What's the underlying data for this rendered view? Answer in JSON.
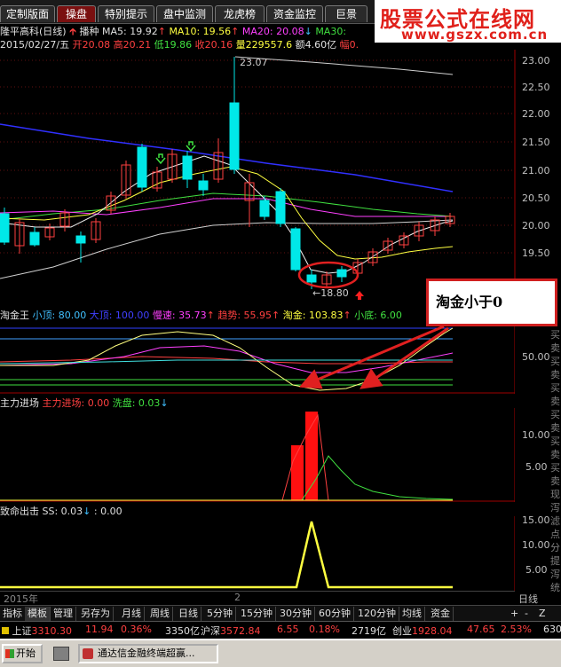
{
  "tabs": [
    {
      "label": "定制版面",
      "active": false
    },
    {
      "label": "操盘",
      "active": true
    },
    {
      "label": "特别提示",
      "active": false
    },
    {
      "label": "盘中监测",
      "active": false
    },
    {
      "label": "龙虎榜",
      "active": false
    },
    {
      "label": "资金监控",
      "active": false
    },
    {
      "label": "巨景",
      "active": false
    }
  ],
  "brand": {
    "title": "股票公式在线网",
    "url": "www.gszx.com.cn"
  },
  "stock_line": {
    "name": "隆平高科(日线)",
    "broadcast": "播种",
    "ma5": "MA5: 19.92",
    "ma10": "MA10: 19.56",
    "ma20": "MA20: 20.08",
    "ma30": "MA30:"
  },
  "ohlc_line": {
    "date": "2015/02/27/五",
    "open": "开20.08",
    "high": "高20.21",
    "low": "低19.86",
    "close": "收20.16",
    "vol": "量229557.6",
    "amount": "额4.60亿",
    "amp": "幅0."
  },
  "main_chart": {
    "yticks": [
      "23.00",
      "22.50",
      "22.00",
      "21.50",
      "21.00",
      "20.50",
      "20.00",
      "19.50"
    ],
    "high_label": "23.07",
    "low_label": "18.80"
  },
  "taojin": {
    "title": "淘金王",
    "items": [
      {
        "label": "小顶: 80.00",
        "color": "#40c0ff"
      },
      {
        "label": "大顶: 100.00",
        "color": "#4040ff"
      },
      {
        "label": "慢速: 35.73",
        "color": "#ff40ff"
      },
      {
        "label": "趋势: 55.95",
        "color": "#ff4040"
      },
      {
        "label": "淘金: 103.83",
        "color": "#ffff40"
      },
      {
        "label": "小底: 6.00",
        "color": "#40e040"
      }
    ],
    "ytick": "50.00"
  },
  "zhuli": {
    "title": "主力进场",
    "items": [
      {
        "label": "主力进场: 0.00",
        "color": "#ff4040"
      },
      {
        "label": "洗盘: 0.03",
        "color": "#40e040"
      }
    ],
    "yticks": [
      "10.00",
      "5.00"
    ]
  },
  "zhiming": {
    "title": "致命出击",
    "items": [
      {
        "label": "SS: 0.03",
        "color": "#e0e0e0"
      },
      {
        "label": ": 0.00",
        "color": "#e0e0e0"
      }
    ],
    "yticks": [
      "15.00",
      "10.00",
      "5.00"
    ]
  },
  "callout": {
    "text": "淘金小于0"
  },
  "time_axis": {
    "year": "2015年",
    "mark": "2",
    "period": "日线"
  },
  "side_text": [
    "买",
    "卖",
    "买",
    "卖",
    "买",
    "卖",
    "买",
    "卖",
    "买",
    "卖",
    "买",
    "卖",
    "现",
    "泻",
    "滤",
    "点",
    "分",
    "提",
    "泻",
    "统"
  ],
  "bottom_tabs": [
    {
      "label": "指标",
      "active": false
    },
    {
      "label": "模板",
      "active": true
    },
    {
      "label": "管理",
      "active": false
    },
    {
      "label": "另存为",
      "active": false
    },
    {
      "label": "月线",
      "active": false
    },
    {
      "label": "周线",
      "active": false
    },
    {
      "label": "日线",
      "active": false
    },
    {
      "label": "5分钟",
      "active": false
    },
    {
      "label": "15分钟",
      "active": false
    },
    {
      "label": "30分钟",
      "active": false
    },
    {
      "label": "60分钟",
      "active": false
    },
    {
      "label": "120分钟",
      "active": false
    },
    {
      "label": "均线",
      "active": false
    },
    {
      "label": "资金",
      "active": false
    }
  ],
  "ticker": {
    "sh_label": "上证",
    "sh_val": "3310.30",
    "sh_chg": "11.94",
    "sh_pct": "0.36%",
    "sh_amt": "3350亿",
    "sz_label": "沪深",
    "sz_val": "3572.84",
    "sz_chg": "6.55",
    "sz_pct": "0.18%",
    "sz_amt": "2719亿",
    "cy_label": "创业",
    "cy_val": "1928.04",
    "cy_chg": "47.65",
    "cy_pct": "2.53%",
    "tail": "630"
  },
  "taskbar": {
    "start": "开始",
    "task": "通达信金融终端超赢..."
  },
  "colors": {
    "up": "#00ffff",
    "down": "#ff4040",
    "accent": "#e0201a"
  }
}
